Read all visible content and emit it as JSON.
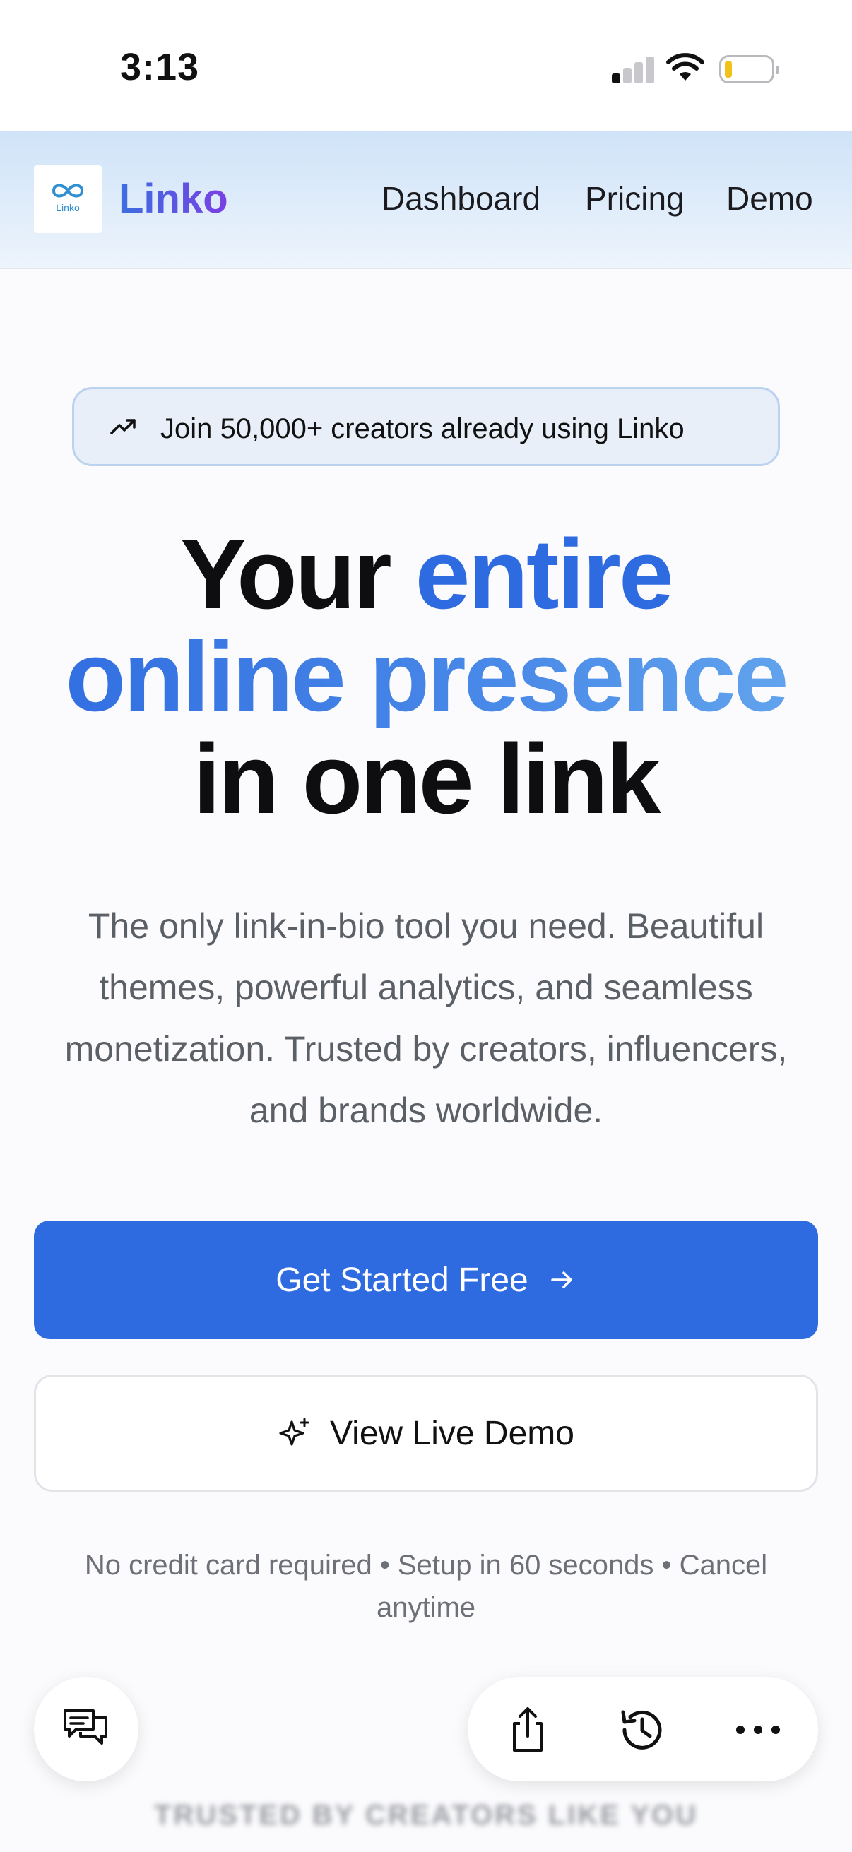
{
  "status_bar": {
    "time": "3:13",
    "signal_icon": "cellular-signal-icon",
    "wifi_icon": "wifi-icon",
    "battery_icon": "battery-low-icon",
    "battery_color": "#f2c21b"
  },
  "nav": {
    "brand": "Linko",
    "logo_small_text": "Linko",
    "links": [
      "Dashboard",
      "Pricing",
      "Demo"
    ],
    "brand_gradient": [
      "#3c6fe0",
      "#7a3fe3"
    ]
  },
  "hero": {
    "badge_icon": "trending-up-icon",
    "badge_text": "Join 50,000+ creators already using Linko",
    "headline": {
      "part1": "Your ",
      "part2": "entire",
      "part3": "online presence",
      "part4": "in one link"
    },
    "subtitle": "The only link-in-bio tool you need. Beautiful themes, powerful analytics, and seamless monetization. Trusted by creators, influencers, and brands worldwide.",
    "primary_button": "Get Started Free",
    "primary_button_icon": "arrow-right-icon",
    "secondary_button": "View Live Demo",
    "secondary_button_icon": "sparkles-icon",
    "note": "No credit card required • Setup in 60 seconds • Cancel anytime",
    "accent_color": "#2f6be0"
  },
  "floating": {
    "chat_icon": "chat-bubbles-icon",
    "toolbar_icons": [
      "share-icon",
      "history-icon",
      "more-icon"
    ]
  },
  "trusted_heading": "TRUSTED BY CREATORS LIKE YOU"
}
